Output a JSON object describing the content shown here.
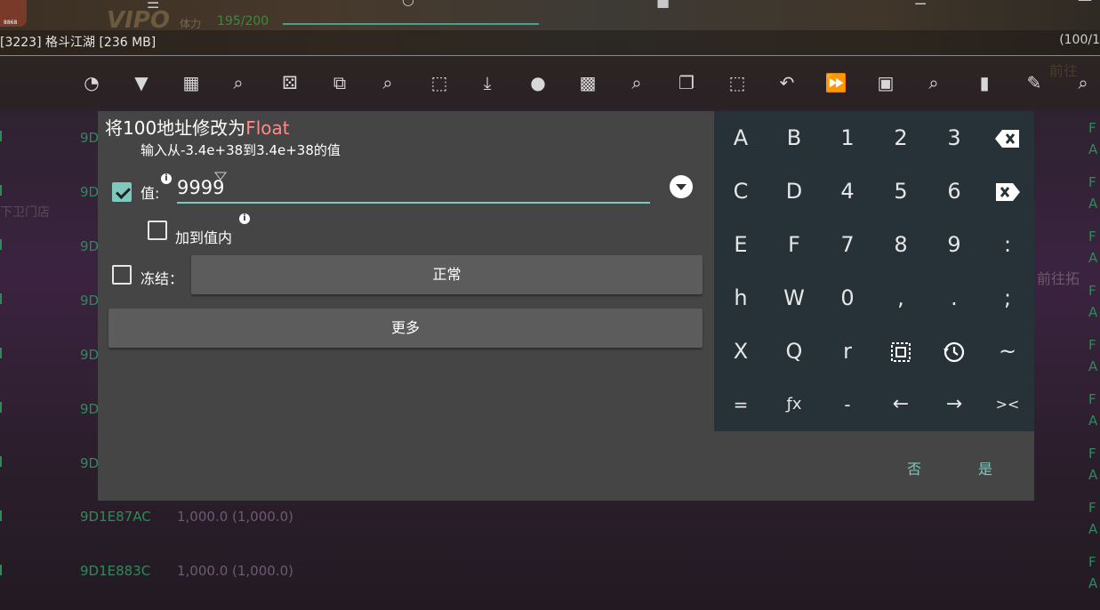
{
  "background": {
    "avatar_badge": "8868",
    "game_title_ghost": "VIPO",
    "hp_label": "体力",
    "hp_value": "195/200",
    "process_label": "[3223] 格斗江湖 [236 MB]",
    "process_count": "(100/1",
    "right_ghost_1": "前往",
    "right_ghost_2": "前往拓",
    "left_ghost": "下卫门店",
    "rows": [
      {
        "addr": "9D",
        "value": ""
      },
      {
        "addr": "9D",
        "value": ""
      },
      {
        "addr": "9D",
        "value": ""
      },
      {
        "addr": "9D",
        "value": ""
      },
      {
        "addr": "9D",
        "value": ""
      },
      {
        "addr": "9D",
        "value": ""
      },
      {
        "addr": "9D",
        "value": ""
      },
      {
        "addr": "9D1E87AC",
        "value": "1,000.0 (1,000.0)"
      },
      {
        "addr": "9D1E883C",
        "value": "1,000.0 (1,000.0)"
      }
    ],
    "row_flags": [
      "F",
      "A",
      "F",
      "A",
      "F",
      "A",
      "F",
      "A",
      "F",
      "A",
      "F",
      "A",
      "F",
      "A",
      "F",
      "A",
      "F",
      "A"
    ]
  },
  "toolbar": {
    "icons": [
      "speedometer-icon",
      "filter-icon",
      "calculator-icon",
      "fuzzy-search-icon",
      "dice-icon",
      "memory-edit-icon",
      "search-check-icon",
      "select-off-icon",
      "import-icon",
      "record-icon",
      "chip-icon",
      "search-hash-icon",
      "copy-icon",
      "select-all-icon",
      "undo-icon",
      "fast-forward-icon",
      "save-icon",
      "search-help-icon",
      "delete-icon",
      "feedback-icon",
      "search-icon"
    ]
  },
  "dialog": {
    "title_prefix": "将100地址修改为",
    "title_type": "Float",
    "subtitle": "输入从-3.4e+38到3.4e+38的值",
    "value_label": "值:",
    "value": "9999",
    "value_checked": true,
    "add_to_value_label": "加到值内",
    "add_to_value_checked": false,
    "freeze_label": "冻结：",
    "freeze_checked": false,
    "freeze_mode": "正常",
    "more_label": "更多",
    "cancel_label": "否",
    "ok_label": "是"
  },
  "keypad": {
    "rows": [
      [
        "A",
        "B",
        "1",
        "2",
        "3",
        "⌫"
      ],
      [
        "C",
        "D",
        "4",
        "5",
        "6",
        "⌫"
      ],
      [
        "E",
        "F",
        "7",
        "8",
        "9",
        ":"
      ],
      [
        "h",
        "W",
        "0",
        ",",
        ".",
        ";"
      ],
      [
        "X",
        "Q",
        "r",
        "▣",
        "⟲",
        "~"
      ],
      [
        "=",
        "ƒx",
        "-",
        "←",
        "→",
        "><"
      ]
    ]
  },
  "colors": {
    "dialog_bg": "#454545",
    "keypad_bg": "#263238",
    "accent": "#7ec8c0",
    "highlight": "#ff8a8a",
    "address_green": "#2f8a5a"
  }
}
